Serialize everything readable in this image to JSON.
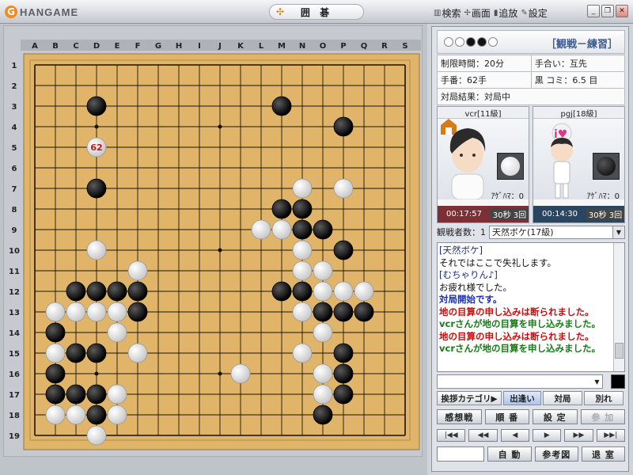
{
  "app": {
    "logo_text": "HANGAME",
    "title": "囲 碁"
  },
  "menu": [
    {
      "label": "検索",
      "icon": "binoculars-icon"
    },
    {
      "label": "画面",
      "icon": "grid-icon"
    },
    {
      "label": "追放",
      "icon": "trash-icon"
    },
    {
      "label": "設定",
      "icon": "wrench-icon"
    }
  ],
  "board": {
    "size": 19,
    "columns": [
      "A",
      "B",
      "C",
      "D",
      "E",
      "F",
      "G",
      "H",
      "I",
      "J",
      "K",
      "L",
      "M",
      "N",
      "O",
      "P",
      "Q",
      "R",
      "S"
    ],
    "rows": [
      "1",
      "2",
      "3",
      "4",
      "5",
      "6",
      "7",
      "8",
      "9",
      "10",
      "11",
      "12",
      "13",
      "14",
      "15",
      "16",
      "17",
      "18",
      "19"
    ],
    "black": [
      "D3",
      "M3",
      "P4",
      "D7",
      "M8",
      "N8",
      "N9",
      "O9",
      "P10",
      "C12",
      "D12",
      "E12",
      "F12",
      "M12",
      "N12",
      "F13",
      "O13",
      "P13",
      "Q13",
      "B14",
      "C15",
      "D15",
      "P15",
      "B16",
      "P16",
      "B17",
      "C17",
      "D17",
      "P17",
      "D18",
      "O18"
    ],
    "white": [
      "N7",
      "P7",
      "L9",
      "M9",
      "D10",
      "N10",
      "F11",
      "N11",
      "O11",
      "O12",
      "P12",
      "Q12",
      "B13",
      "C13",
      "D13",
      "E13",
      "N13",
      "E14",
      "O14",
      "B15",
      "F15",
      "N15",
      "K16",
      "O16",
      "E17",
      "O17",
      "B18",
      "C18",
      "E18",
      "D19"
    ],
    "last_move": {
      "point": "D5",
      "color": "white",
      "number": "62"
    }
  },
  "info": {
    "mode": "［観戦－練習］",
    "time_limit": "制限時間：20分",
    "handicap": "手合い：互先",
    "moves": "手番：62手",
    "komi": "黒 コミ：6.5 目",
    "result": "対局結果：対局中"
  },
  "players": [
    {
      "name": "vcr[11級]",
      "stone": "white",
      "captures": "ｱｹﾞﾊﾏ：0",
      "time": "00:17:57",
      "byoyomi": "30秒 3回"
    },
    {
      "name": "pgj[18級]",
      "stone": "black",
      "captures": "ｱｹﾞﾊﾏ：0",
      "time": "00:14:30",
      "byoyomi": "30秒 3回"
    }
  ],
  "watchers": {
    "label": "観戦者数：1",
    "selected": "天然ボケ(17級)"
  },
  "chat": [
    {
      "text": "[天然ボケ]",
      "color": "#1b2f8a",
      "bold": false
    },
    {
      "text": "それではここで失礼します。",
      "color": "#111111",
      "bold": false
    },
    {
      "text": "[むちゃりん♪]",
      "color": "#1b2f8a",
      "bold": false
    },
    {
      "text": "お疲れ様でした。",
      "color": "#111111",
      "bold": false
    },
    {
      "text": "対局開始です。",
      "color": "#1a2fb0",
      "bold": true
    },
    {
      "text": "地の目算の申し込みは断られました。",
      "color": "#c41212",
      "bold": true
    },
    {
      "text": "vcrさんが地の目算を申し込みました。",
      "color": "#1a7a1a",
      "bold": true
    },
    {
      "text": "地の目算の申し込みは断られました。",
      "color": "#c41212",
      "bold": true
    },
    {
      "text": "vcrさんが地の目算を申し込みました。",
      "color": "#1a7a1a",
      "bold": true
    }
  ],
  "chat_input": {
    "value": ""
  },
  "greet": {
    "label": "挨拶カテゴリ▶",
    "tabs": [
      "出逢い",
      "対局",
      "別れ"
    ]
  },
  "buttons": {
    "row1": [
      "感想戦",
      "順 番",
      "設 定",
      "参 加"
    ],
    "nav": [
      "|◀◀",
      "◀◀",
      "◀",
      "▶",
      "▶▶",
      "▶▶|"
    ],
    "row3": [
      "自 動",
      "参考図",
      "退 室"
    ]
  }
}
